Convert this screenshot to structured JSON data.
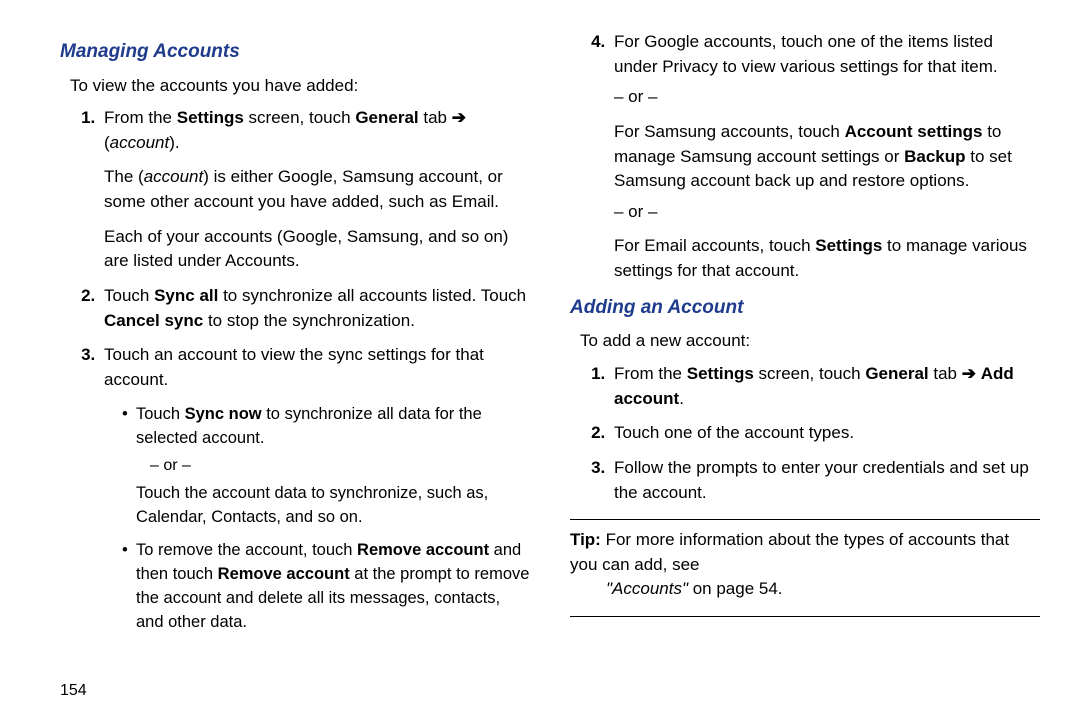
{
  "page_number": "154",
  "left": {
    "heading": "Managing Accounts",
    "intro": "To view the accounts you have added:",
    "step1_a": "From the ",
    "step1_b": "Settings",
    "step1_c": " screen, touch ",
    "step1_d": "General",
    "step1_e": " tab ",
    "step1_arrow": "➔",
    "step1_f": "(",
    "step1_g": "account",
    "step1_h": ").",
    "step1_exp_a": "The (",
    "step1_exp_b": "account",
    "step1_exp_c": ") is either Google, Samsung account, or some other account you have added, such as Email.",
    "step1_exp2": "Each of your accounts (Google, Samsung, and so on) are listed under Accounts.",
    "step2_a": "Touch ",
    "step2_b": "Sync all",
    "step2_c": " to synchronize all accounts listed. Touch ",
    "step2_d": "Cancel sync",
    "step2_e": " to stop the synchronization.",
    "step3": "Touch an account to view the sync settings for that account.",
    "b1_a": "Touch ",
    "b1_b": "Sync now",
    "b1_c": " to synchronize all data for the selected account.",
    "b_or": "– or –",
    "b_after": "Touch the account data to synchronize, such as, Calendar, Contacts, and so on.",
    "b2_a": "To remove the account, touch ",
    "b2_b": "Remove account",
    "b2_c": " and then touch ",
    "b2_d": "Remove account",
    "b2_e": " at the prompt to remove the account and delete all its messages, contacts, and other data."
  },
  "right": {
    "step4": "For Google accounts, touch one of the items listed under Privacy to view various settings for that item.",
    "or1": "– or –",
    "sams_a": "For Samsung accounts, touch ",
    "sams_b": "Account settings",
    "sams_c": " to manage Samsung account settings or ",
    "sams_d": "Backup",
    "sams_e": " to set Samsung account back up and restore options.",
    "or2": "– or –",
    "email_a": "For Email accounts, touch ",
    "email_b": "Settings",
    "email_c": " to manage various settings for that account.",
    "heading2": "Adding an Account",
    "intro2": "To add a new account:",
    "a1_a": "From the ",
    "a1_b": "Settings",
    "a1_c": " screen, touch ",
    "a1_d": "General",
    "a1_e": " tab ",
    "a1_arrow": "➔",
    "a1_f": "Add account",
    "a1_g": ".",
    "a2": "Touch one of the account types.",
    "a3": "Follow the prompts to enter your credentials and set up the account.",
    "tip_a": "Tip:",
    "tip_b": " For more information about the types of accounts that you can add, see ",
    "tip_c": "\"Accounts\"",
    "tip_d": " on page 54."
  }
}
